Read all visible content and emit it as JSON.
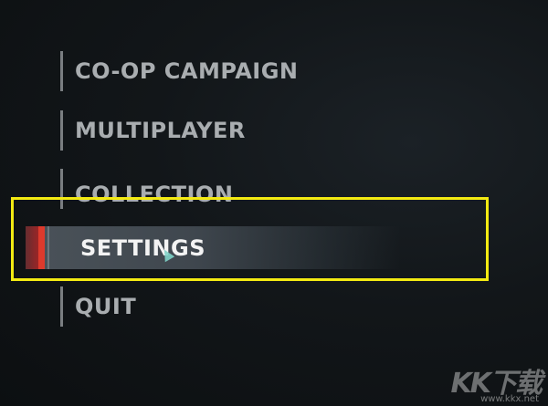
{
  "main_menu": {
    "items": [
      {
        "label": "CO-OP CAMPAIGN"
      },
      {
        "label": "MULTIPLAYER"
      },
      {
        "label": "COLLECTION"
      },
      {
        "label": "SETTINGS"
      },
      {
        "label": "QUIT"
      }
    ],
    "selected_index": 3
  },
  "watermark": {
    "logo_text": "KK下载",
    "url": "www.kkx.net"
  },
  "colors": {
    "background": "#121619",
    "menu_text": "#a9adb0",
    "selected_text": "#f3f3f3",
    "selected_accent": "#dd3a2c",
    "annotation_box": "#f3ea12"
  }
}
